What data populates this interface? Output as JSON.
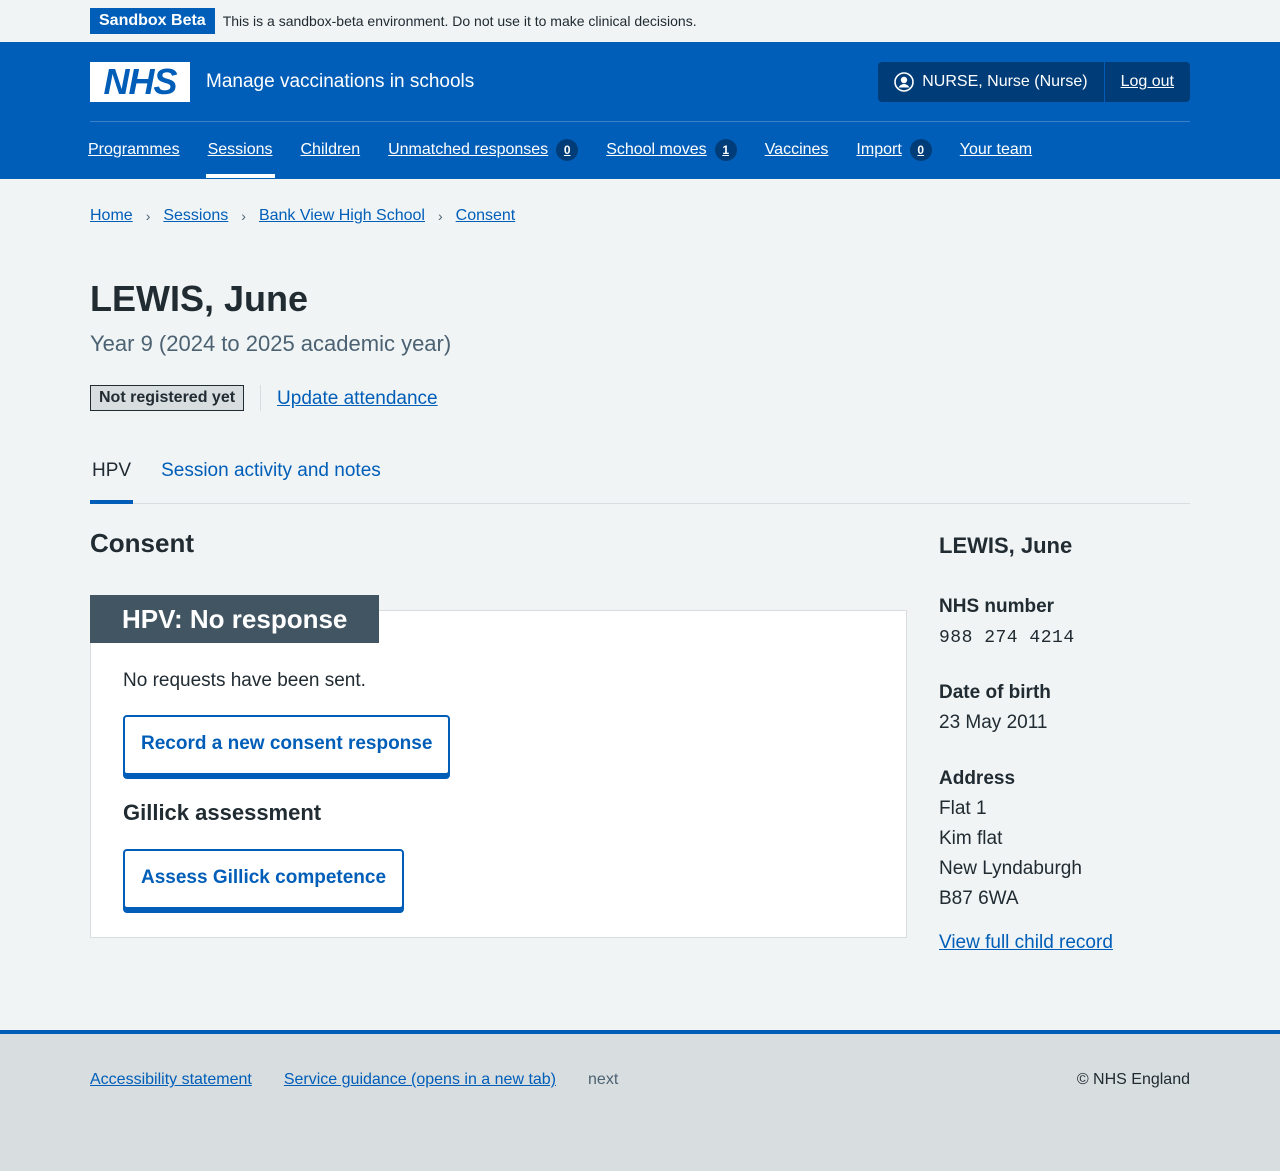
{
  "env_banner": {
    "tag": "Sandbox Beta",
    "text": "This is a sandbox-beta environment. Do not use it to make clinical decisions."
  },
  "header": {
    "logo_text": "NHS",
    "service_name": "Manage vaccinations in schools",
    "account_user": "NURSE, Nurse (Nurse)",
    "logout_label": "Log out",
    "nav": [
      {
        "label": "Programmes"
      },
      {
        "label": "Sessions"
      },
      {
        "label": "Children"
      },
      {
        "label": "Unmatched responses",
        "count": "0"
      },
      {
        "label": "School moves",
        "count": "1"
      },
      {
        "label": "Vaccines"
      },
      {
        "label": "Import",
        "count": "0"
      },
      {
        "label": "Your team"
      }
    ]
  },
  "breadcrumb": [
    "Home",
    "Sessions",
    "Bank View High School",
    "Consent"
  ],
  "page": {
    "title": "LEWIS, June",
    "caption": "Year 9 (2024 to 2025 academic year)",
    "status_tag": "Not registered yet",
    "update_link": "Update attendance",
    "tabs": [
      "HPV",
      "Session activity and notes"
    ]
  },
  "consent": {
    "section_title": "Consent",
    "card_heading": "HPV: No response",
    "no_requests": "No requests have been sent.",
    "record_button": "Record a new consent response",
    "gillick_heading": "Gillick assessment",
    "gillick_button": "Assess Gillick competence"
  },
  "sidebar": {
    "name": "LEWIS, June",
    "nhs_label": "NHS number",
    "nhs_value": "988 274 4214",
    "dob_label": "Date of birth",
    "dob_value": "23 May 2011",
    "address_label": "Address",
    "address_lines": [
      "Flat 1",
      "Kim flat",
      "New Lyndaburgh",
      "B87 6WA"
    ],
    "view_record": "View full child record"
  },
  "footer": {
    "accessibility": "Accessibility statement",
    "guidance": "Service guidance (opens in a new tab)",
    "version": "next",
    "copyright": "© NHS England"
  }
}
